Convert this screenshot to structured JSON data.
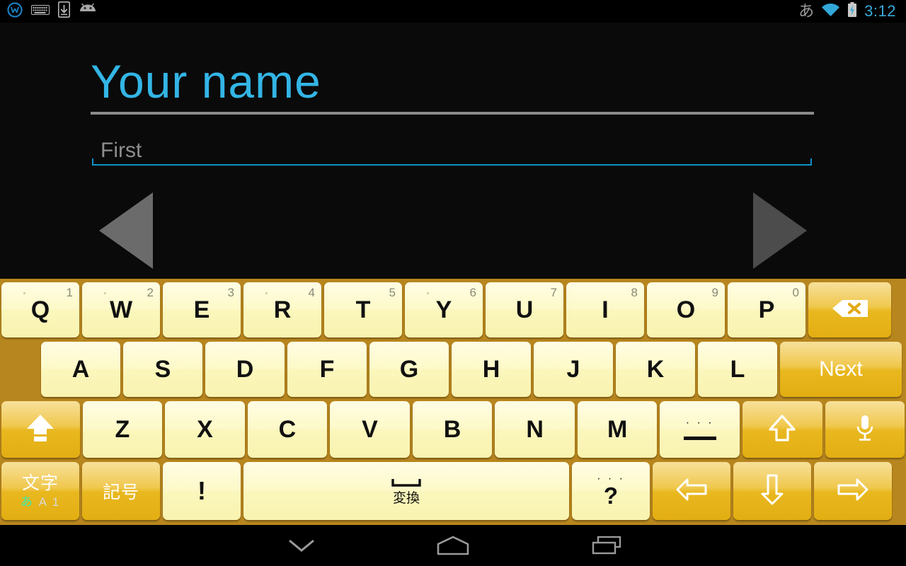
{
  "status_bar": {
    "left_icons": [
      {
        "name": "app-logo-icon",
        "label": "W"
      },
      {
        "name": "keyboard-icon",
        "label": "keyboard"
      },
      {
        "name": "download-to-device-icon",
        "label": "download"
      },
      {
        "name": "android-robot-icon",
        "label": "android"
      }
    ],
    "ime_indicator": "あ",
    "wifi_icon": "wifi-icon",
    "battery_icon": "battery-charging-icon",
    "clock": "3:12"
  },
  "app": {
    "title": "Your name",
    "title_color": "#33b5e5",
    "name_field": {
      "value": "",
      "placeholder": "First"
    },
    "prev_label": "previous",
    "next_label": "next"
  },
  "keyboard": {
    "background_color": "#b8861e",
    "light_key_color": "#fdf9c8",
    "gold_key_color": "#e9b81f",
    "row1": [
      {
        "key": "Q",
        "hint": "1"
      },
      {
        "key": "W",
        "hint": "2"
      },
      {
        "key": "E",
        "hint": "3"
      },
      {
        "key": "R",
        "hint": "4"
      },
      {
        "key": "T",
        "hint": "5"
      },
      {
        "key": "Y",
        "hint": "6"
      },
      {
        "key": "U",
        "hint": "7"
      },
      {
        "key": "I",
        "hint": "8"
      },
      {
        "key": "O",
        "hint": "9"
      },
      {
        "key": "P",
        "hint": "0"
      }
    ],
    "backspace": "backspace-key",
    "row2": [
      {
        "key": "A"
      },
      {
        "key": "S"
      },
      {
        "key": "D"
      },
      {
        "key": "F"
      },
      {
        "key": "G"
      },
      {
        "key": "H"
      },
      {
        "key": "J"
      },
      {
        "key": "K"
      },
      {
        "key": "L"
      }
    ],
    "enter_label": "Next",
    "row3": [
      {
        "key": "Z"
      },
      {
        "key": "X"
      },
      {
        "key": "C"
      },
      {
        "key": "V"
      },
      {
        "key": "B"
      },
      {
        "key": "N"
      },
      {
        "key": "M"
      }
    ],
    "shift_label": "shift-key",
    "dash_key": {
      "dots": "· · ·",
      "glyph": "—"
    },
    "arrow_up_label": "arrow-up-key",
    "mic_label": "microphone-key",
    "mode_char": {
      "main": "文字",
      "hira": "あ",
      "roman": "A",
      "num": "1"
    },
    "mode_symbol": {
      "main": "記号"
    },
    "exclaim": "!",
    "space": {
      "label": "変換"
    },
    "question": {
      "dots": "· · ·",
      "glyph": "?"
    },
    "arrow_left_label": "arrow-left-key",
    "arrow_down_label": "arrow-down-key",
    "arrow_right_label": "arrow-right-key"
  },
  "navbar": {
    "hide_keyboard": "hide-keyboard-button",
    "home": "home-button",
    "recents": "recents-button"
  }
}
